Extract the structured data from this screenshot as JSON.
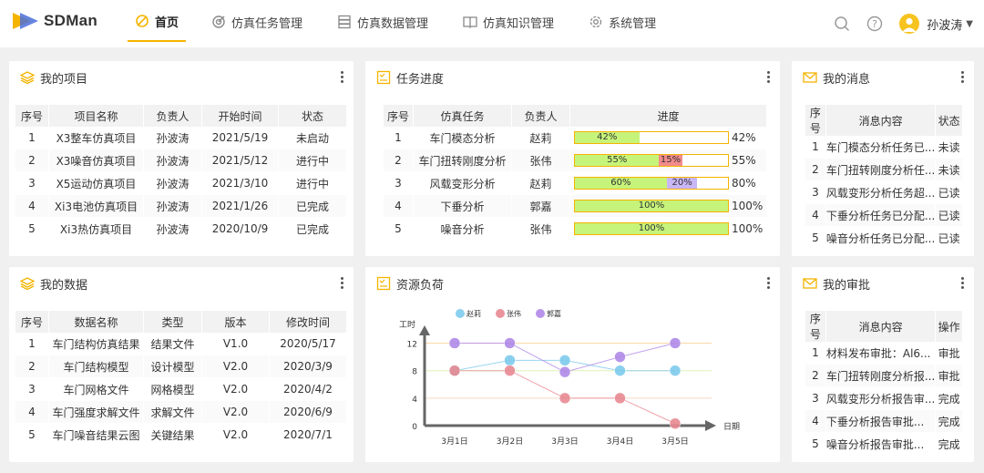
{
  "app": {
    "name": "SDMan"
  },
  "nav": [
    {
      "label": "首页",
      "icon": "home-icon",
      "active": true
    },
    {
      "label": "仿真任务管理",
      "icon": "target-icon",
      "active": false
    },
    {
      "label": "仿真数据管理",
      "icon": "database-icon",
      "active": false
    },
    {
      "label": "仿真知识管理",
      "icon": "book-icon",
      "active": false
    },
    {
      "label": "系统管理",
      "icon": "gear-icon",
      "active": false
    }
  ],
  "user": {
    "name": "孙波涛"
  },
  "colors": {
    "accent": "#f5b400",
    "green": "#c6f47a",
    "red": "#f28b8b",
    "purple": "#c9b6f6",
    "header_bg": "#f2f2f2"
  },
  "projects": {
    "title": "我的项目",
    "columns": [
      "序号",
      "项目名称",
      "负责人",
      "开始时间",
      "状态"
    ],
    "rows": [
      [
        "1",
        "X3整车仿真项目",
        "孙波涛",
        "2021/5/19",
        "未启动"
      ],
      [
        "2",
        "X3噪音仿真项目",
        "孙波涛",
        "2021/5/12",
        "进行中"
      ],
      [
        "3",
        "X5运动仿真项目",
        "孙波涛",
        "2021/3/10",
        "进行中"
      ],
      [
        "4",
        "Xi3电池仿真项目",
        "孙波涛",
        "2021/1/26",
        "已完成"
      ],
      [
        "5",
        "Xi3热仿真项目",
        "孙波涛",
        "2020/10/9",
        "已完成"
      ]
    ]
  },
  "tasks": {
    "title": "任务进度",
    "columns": [
      "序号",
      "仿真任务",
      "负责人",
      "进度"
    ],
    "rows": [
      {
        "no": "1",
        "task": "车门模态分析",
        "owner": "赵莉",
        "segments": [
          {
            "value": 42,
            "label": "42%",
            "color": "#c6f47a"
          }
        ],
        "total": "42%"
      },
      {
        "no": "2",
        "task": "车门扭转刚度分析",
        "owner": "张伟",
        "segments": [
          {
            "value": 55,
            "label": "55%",
            "color": "#c6f47a"
          },
          {
            "value": 15,
            "label": "15%",
            "color": "#f28b8b"
          }
        ],
        "total": "55%"
      },
      {
        "no": "3",
        "task": "风载变形分析",
        "owner": "赵莉",
        "segments": [
          {
            "value": 60,
            "label": "60%",
            "color": "#c6f47a"
          },
          {
            "value": 20,
            "label": "20%",
            "color": "#c9b6f6"
          }
        ],
        "total": "80%"
      },
      {
        "no": "4",
        "task": "下垂分析",
        "owner": "郭嘉",
        "segments": [
          {
            "value": 100,
            "label": "100%",
            "color": "#c6f47a"
          }
        ],
        "total": "100%"
      },
      {
        "no": "5",
        "task": "噪音分析",
        "owner": "张伟",
        "segments": [
          {
            "value": 100,
            "label": "100%",
            "color": "#c6f47a"
          }
        ],
        "total": "100%"
      }
    ]
  },
  "messages": {
    "title": "我的消息",
    "columns": [
      "序号",
      "消息内容",
      "状态"
    ],
    "rows": [
      [
        "1",
        "车门模态分析任务已...",
        "未读"
      ],
      [
        "2",
        "车门扭转刚度分析任...",
        "未读"
      ],
      [
        "3",
        "风载变形分析任务超...",
        "已读"
      ],
      [
        "4",
        "下垂分析任务已分配...",
        "已读"
      ],
      [
        "5",
        "噪音分析任务已分配...",
        "已读"
      ]
    ]
  },
  "data": {
    "title": "我的数据",
    "columns": [
      "序号",
      "数据名称",
      "类型",
      "版本",
      "修改时间"
    ],
    "rows": [
      [
        "1",
        "车门结构仿真结果",
        "结果文件",
        "V1.0",
        "2020/5/17"
      ],
      [
        "2",
        "车门结构模型",
        "设计模型",
        "V2.0",
        "2020/3/9"
      ],
      [
        "3",
        "车门网格文件",
        "网格模型",
        "V2.0",
        "2020/4/2"
      ],
      [
        "4",
        "车门强度求解文件",
        "求解文件",
        "V2.0",
        "2020/6/9"
      ],
      [
        "5",
        "车门噪音结果云图",
        "关键结果",
        "V2.0",
        "2020/7/1"
      ]
    ]
  },
  "resource": {
    "title": "资源负荷"
  },
  "approvals": {
    "title": "我的审批",
    "columns": [
      "序号",
      "消息内容",
      "操作"
    ],
    "rows": [
      [
        "1",
        "材料发布审批：Al6...",
        "审批"
      ],
      [
        "2",
        "车门扭转刚度分析报...",
        "审批"
      ],
      [
        "3",
        "风载变形分析报告审...",
        "完成"
      ],
      [
        "4",
        "下垂分析报告审批...",
        "完成"
      ],
      [
        "5",
        "噪音分析报告审批...",
        "完成"
      ]
    ]
  },
  "chart_data": {
    "type": "line",
    "title": "",
    "xlabel": "日期",
    "ylabel": "工时",
    "categories": [
      "3月1日",
      "3月2日",
      "3月3日",
      "3月4日",
      "3月5日"
    ],
    "yticks": [
      0,
      4,
      8,
      12
    ],
    "ylim": [
      0,
      13
    ],
    "legend_position": "top",
    "series": [
      {
        "name": "赵莉",
        "color": "#7ecbed",
        "values": [
          8,
          9.5,
          9.5,
          8,
          8
        ]
      },
      {
        "name": "张伟",
        "color": "#e88a93",
        "values": [
          8,
          8,
          4,
          4,
          0.3
        ]
      },
      {
        "name": "郭嘉",
        "color": "#b08ae8",
        "values": [
          12,
          12,
          7.8,
          10,
          12
        ]
      }
    ]
  }
}
